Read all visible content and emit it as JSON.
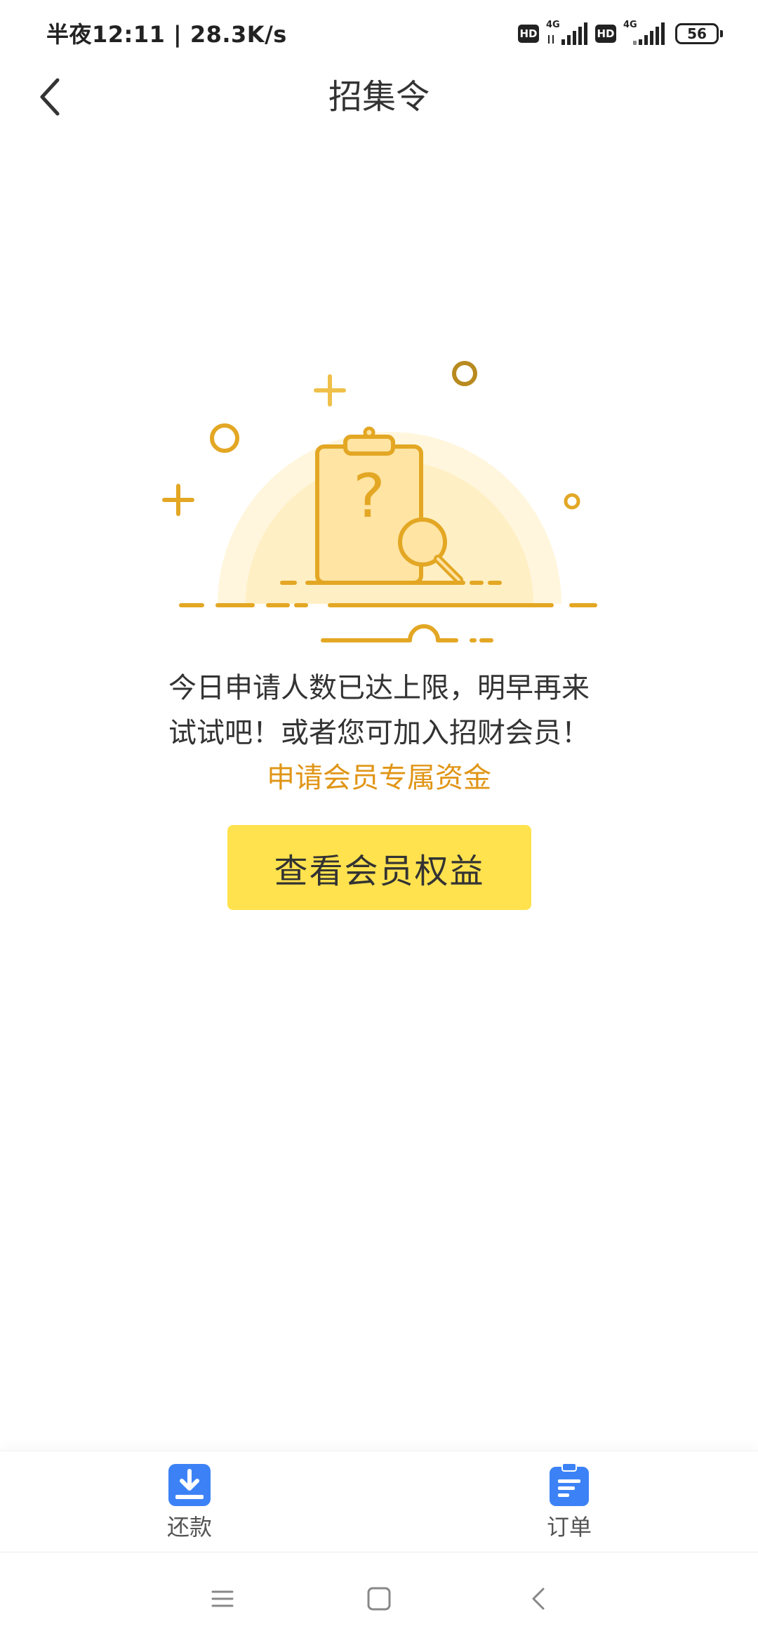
{
  "status_bar": {
    "time_speed": "半夜12:11 | 28.3K/s",
    "hd_label": "HD",
    "network_label": "4G",
    "battery_level": "56"
  },
  "header": {
    "title": "招集令"
  },
  "illustration": {
    "colors": {
      "stroke": "#e3a724",
      "fill": "#ffe4a3",
      "glow": "#fff4d6"
    }
  },
  "message": {
    "line1": "今日申请人数已达上限，明早再来",
    "line2": "试试吧！或者您可加入招财会员！",
    "highlight": "申请会员专属资金",
    "highlight_color": "#e09516"
  },
  "primary_button": {
    "label": "查看会员权益",
    "color": "#ffe24e"
  },
  "tab_bar": {
    "items": [
      {
        "label": "还款",
        "icon": "download-icon"
      },
      {
        "label": "订单",
        "icon": "clipboard-icon"
      }
    ],
    "icon_color": "#3c82f6"
  },
  "system_nav": {
    "items": [
      "menu-icon",
      "home-icon",
      "back-arrow-icon"
    ]
  }
}
